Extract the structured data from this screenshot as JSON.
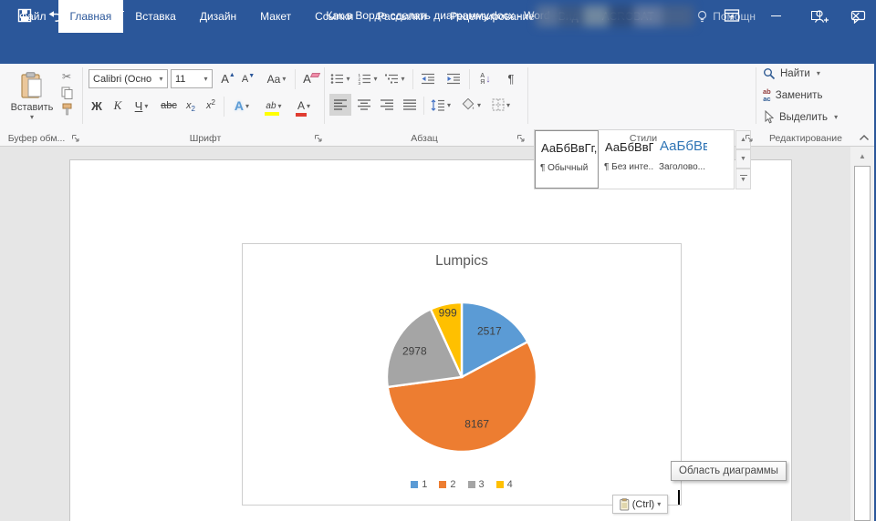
{
  "window": {
    "title": "Как в Ворде сделать диаграмму.docx - Word"
  },
  "quick_access": {
    "save": "save",
    "undo": "undo",
    "redo": "redo",
    "customize": "customize"
  },
  "tabs": [
    {
      "key": "file",
      "label": "Файл",
      "active": false
    },
    {
      "key": "home",
      "label": "Главная",
      "active": true
    },
    {
      "key": "insert",
      "label": "Вставка",
      "active": false
    },
    {
      "key": "design",
      "label": "Дизайн",
      "active": false
    },
    {
      "key": "layout",
      "label": "Макет",
      "active": false
    },
    {
      "key": "references",
      "label": "Ссылки",
      "active": false
    },
    {
      "key": "mailings",
      "label": "Рассылки",
      "active": false
    },
    {
      "key": "review",
      "label": "Рецензирование",
      "active": false
    },
    {
      "key": "view",
      "label": "Вид",
      "active": false
    },
    {
      "key": "acrobat",
      "label": "ACROBAT",
      "active": false
    }
  ],
  "help_tab": {
    "label": "Помощн"
  },
  "ribbon": {
    "clipboard": {
      "paste": "Вставить",
      "group": "Буфер обм..."
    },
    "font": {
      "name": "Calibri (Осно",
      "size": "11",
      "group": "Шрифт",
      "bold": "Ж",
      "italic": "К",
      "underline": "Ч",
      "strike": "abc",
      "subscript_base": "x",
      "subscript_idx": "2",
      "superscript_base": "x",
      "superscript_idx": "2",
      "case_btn": "Aa",
      "effects_letter": "A",
      "highlight_letters": "ab",
      "fontcolor_letter": "А",
      "grow_letter": "A",
      "shrink_letter": "A",
      "clear_letter": "A"
    },
    "paragraph": {
      "group": "Абзац",
      "sort_top": "А",
      "sort_bottom": "Я",
      "pilcrow": "¶"
    },
    "styles": {
      "group": "Стили",
      "cards": [
        {
          "preview": "АаБбВвГг,",
          "name": "¶ Обычный",
          "selected": true
        },
        {
          "preview": "АаБбВвГг,",
          "name": "¶ Без инте...",
          "selected": false
        },
        {
          "preview": "АаБбВв",
          "name": "Заголово...",
          "selected": false
        }
      ]
    },
    "editing": {
      "group": "Редактирование",
      "find": "Найти",
      "replace": "Заменить",
      "select": "Выделить",
      "replace_icon_top": "ab",
      "replace_icon_bottom": "ac"
    }
  },
  "icons": {
    "scissors": "✂"
  },
  "chart_data": {
    "type": "pie",
    "title": "Lumpics",
    "labels": [
      "1",
      "2",
      "3",
      "4"
    ],
    "values": [
      2517,
      8167,
      2978,
      999
    ],
    "colors": [
      "#5B9BD5",
      "#ED7D31",
      "#A5A5A5",
      "#FFC000"
    ],
    "legend_position": "bottom",
    "data_labels": [
      2517,
      8167,
      2978,
      999
    ],
    "start_angle_deg": 0,
    "direction": "clockwise"
  },
  "tooltip": "Область диаграммы",
  "paste_options": {
    "label": "(Ctrl)"
  },
  "colors": {
    "accent": "#2B579A",
    "ribbon_bg": "#F7F7F8",
    "doc_bg": "#E6E6E6"
  }
}
